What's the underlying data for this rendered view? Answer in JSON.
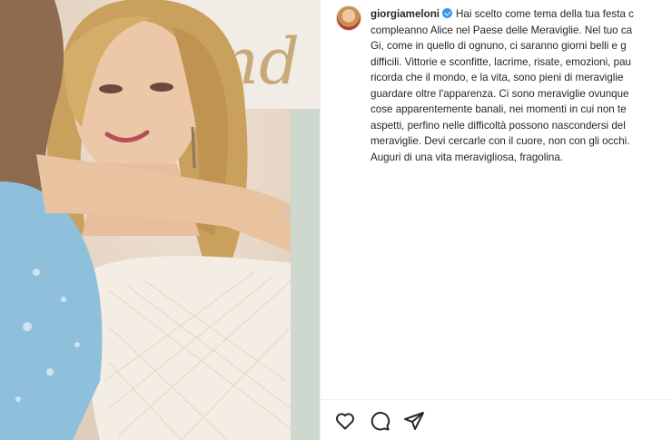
{
  "post": {
    "username": "giorgiameloni",
    "verified": true,
    "photo_sign_text": "nd",
    "caption_lines": [
      "Hai scelto come tema della tua festa c",
      "compleanno Alice nel Paese delle Meraviglie. Nel tuo ca",
      "Gi, come in quello di ognuno, ci saranno giorni belli e g",
      "difficili. Vittorie e sconfitte, lacrime, risate, emozioni, pau",
      "ricorda che il mondo, e la vita, sono pieni di meraviglie",
      "guardare oltre l'apparenza. Ci sono meraviglie ovunque",
      "cose apparentemente banali, nei momenti in cui non te",
      "aspetti, perfino nelle difficoltà possono nascondersi del",
      "meraviglie. Devi cercarle con il cuore, non con gli occhi.",
      "Auguri di una vita meravigliosa, fragolina."
    ]
  },
  "actions": {
    "like_icon": "heart-icon",
    "comment_icon": "comment-icon",
    "share_icon": "send-icon"
  }
}
